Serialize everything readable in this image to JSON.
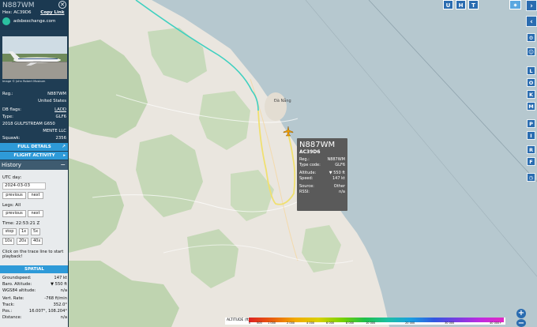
{
  "aircraft": {
    "callsign": "N887WM",
    "hex_label": "Hex:",
    "hex": "AC39D6",
    "copy_link": "Copy Link",
    "site": "adsbexchange.com",
    "photo_credit": "Image © John Robert Mosbum"
  },
  "info": [
    {
      "k": "Reg.:",
      "v": "N887WM"
    },
    {
      "k": "",
      "v": "United States"
    },
    {
      "k": "DB flags:",
      "v": "LADD"
    },
    {
      "k": "Type:",
      "v": "GLF6"
    },
    {
      "k": "2018 GULFSTREAM G650",
      "v": ""
    },
    {
      "k": "",
      "v": "MENTE LLC"
    },
    {
      "k": "Squawk:",
      "v": "2356"
    }
  ],
  "buttons": {
    "full_details": "FULL DETAILS",
    "full_details_icon": "↗",
    "flight_activity": "FLIGHT ACTIVITY",
    "flight_activity_icon": "▸"
  },
  "history": {
    "title": "History",
    "collapse": "−",
    "utc_label": "UTC day:",
    "date": "2024-03-03",
    "previous": "previous",
    "next": "next",
    "legs_label": "Legs: All",
    "time_label": "Time: 22:53:21 Z",
    "stop": "stop",
    "speeds": [
      "1x",
      "5x",
      "10x",
      "20x",
      "40x"
    ],
    "hint": "Click on the trace line to start playback!"
  },
  "spatial": {
    "title": "SPATIAL",
    "rows": [
      {
        "k": "Groundspeed:",
        "v": "147 kt"
      },
      {
        "k": "Baro. Altitude:",
        "v": "▼ 550 ft"
      },
      {
        "k": "WGS84 altitude:",
        "v": "n/a"
      },
      {
        "k": "Vert. Rate:",
        "v": "-768 ft/min"
      },
      {
        "k": "Track:",
        "v": "352.0°"
      },
      {
        "k": "Pos.:",
        "v": "16.007°, 108.204°"
      },
      {
        "k": "Distance:",
        "v": "n/a"
      }
    ]
  },
  "map": {
    "top_buttons": [
      "U",
      "H",
      "T"
    ],
    "side_buttons": [
      "L",
      "O",
      "K",
      "M",
      "P",
      "I",
      "R",
      "F"
    ],
    "city_label": "Đà Nẵng",
    "zoom_in": "+",
    "zoom_out": "−",
    "colors": {
      "land": "#eae6df",
      "sea": "#b6c8cf",
      "forest": "#bfd4b0",
      "trace_cyan": "#3fd0c0",
      "trace_yellow": "#f0e070",
      "aircraft": "#f2a000"
    }
  },
  "popup": {
    "callsign": "N887WM",
    "hex": "AC39D6",
    "rows": [
      {
        "k": "Reg.:",
        "v": "N887WM"
      },
      {
        "k": "Type code:",
        "v": "GLF6"
      },
      {
        "k": "Altitude:",
        "v": "▼ 550 ft"
      },
      {
        "k": "Speed:",
        "v": "147 kt"
      },
      {
        "k": "Source:",
        "v": "Other"
      },
      {
        "k": "RSSI:",
        "v": "n/a"
      }
    ]
  },
  "altitude_legend": {
    "title": "ALTITUDE (ft)",
    "ticks": [
      "0",
      "500",
      "1 000",
      "2 000",
      "4 000",
      "6 000",
      "8 000",
      "10 000",
      "20 000",
      "30 000",
      "40 000+"
    ]
  }
}
